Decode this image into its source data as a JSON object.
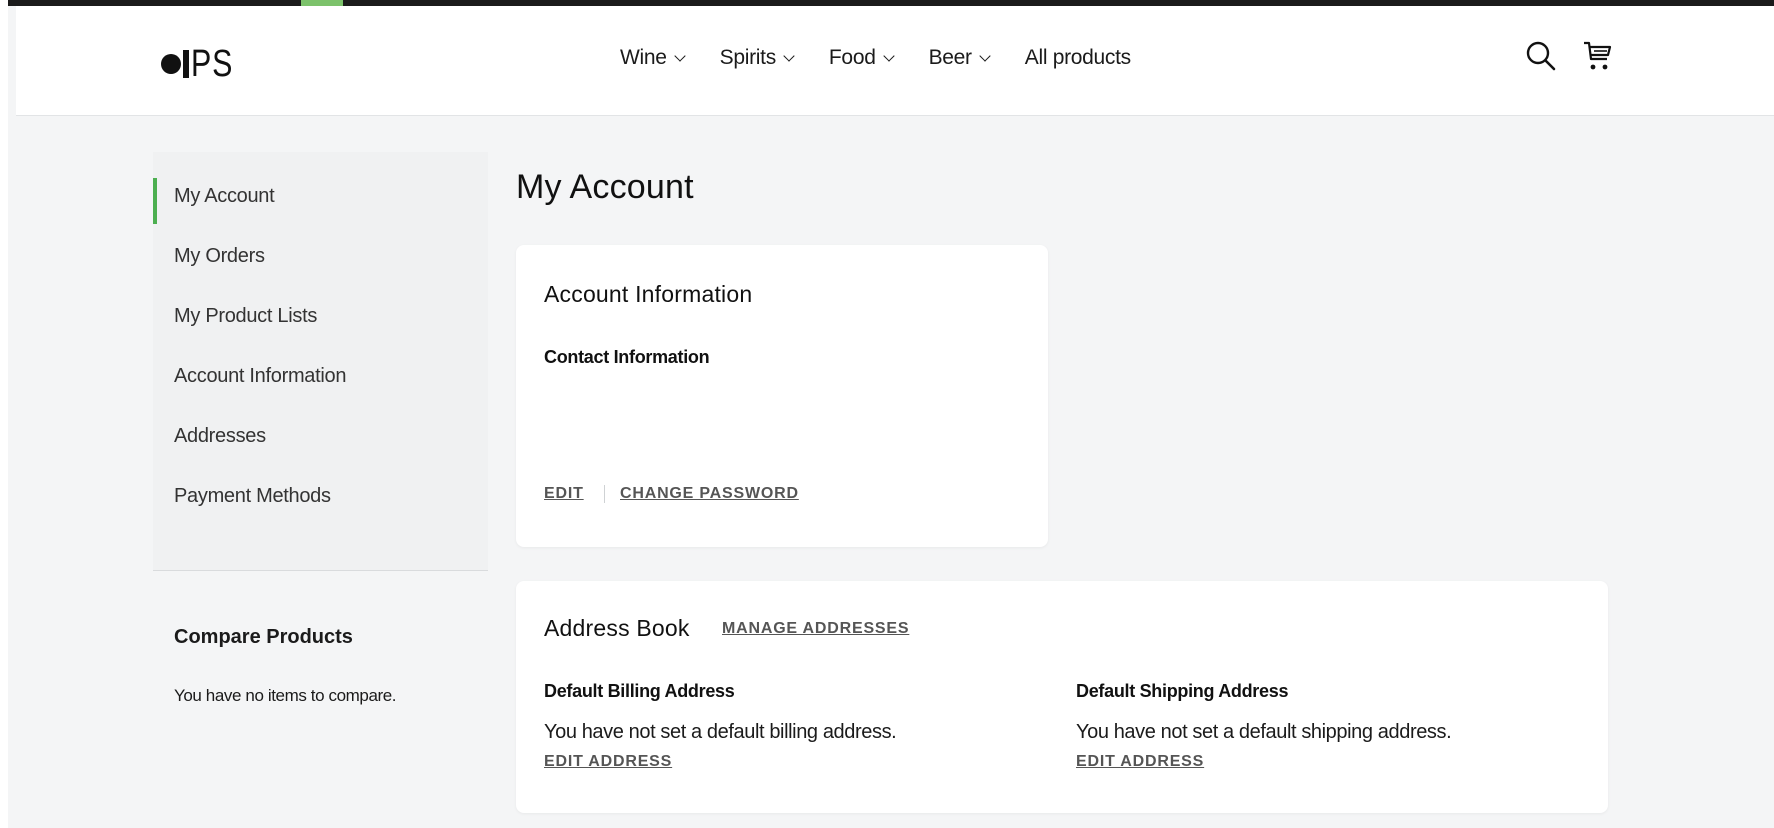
{
  "brand": {
    "logo_text": "PS"
  },
  "nav": {
    "items": [
      {
        "label": "Wine",
        "has_dropdown": true
      },
      {
        "label": "Spirits",
        "has_dropdown": true
      },
      {
        "label": "Food",
        "has_dropdown": true
      },
      {
        "label": "Beer",
        "has_dropdown": true
      },
      {
        "label": "All products",
        "has_dropdown": false
      }
    ],
    "icons": [
      "search-icon",
      "cart-icon"
    ]
  },
  "sidebar": {
    "items": [
      {
        "label": "My Account",
        "active": true
      },
      {
        "label": "My Orders",
        "active": false
      },
      {
        "label": "My Product Lists",
        "active": false
      },
      {
        "label": "Account Information",
        "active": false
      },
      {
        "label": "Addresses",
        "active": false
      },
      {
        "label": "Payment Methods",
        "active": false
      }
    ],
    "compare": {
      "title": "Compare Products",
      "empty_text": "You have no items to compare."
    }
  },
  "main": {
    "title": "My Account",
    "account_info": {
      "title": "Account Information",
      "contact_title": "Contact Information",
      "edit_label": "EDIT",
      "change_password_label": "CHANGE PASSWORD"
    },
    "address_book": {
      "title": "Address Book",
      "manage_label": "MANAGE ADDRESSES",
      "billing": {
        "title": "Default Billing Address",
        "text": "You have not set a default billing address.",
        "edit_label": "EDIT ADDRESS"
      },
      "shipping": {
        "title": "Default Shipping Address",
        "text": "You have not set a default shipping address.",
        "edit_label": "EDIT ADDRESS"
      }
    }
  },
  "colors": {
    "accent_green": "#4caf50",
    "top_accent": "#7cc26b",
    "background": "#f4f5f6",
    "card": "#ffffff",
    "link": "#555555"
  }
}
